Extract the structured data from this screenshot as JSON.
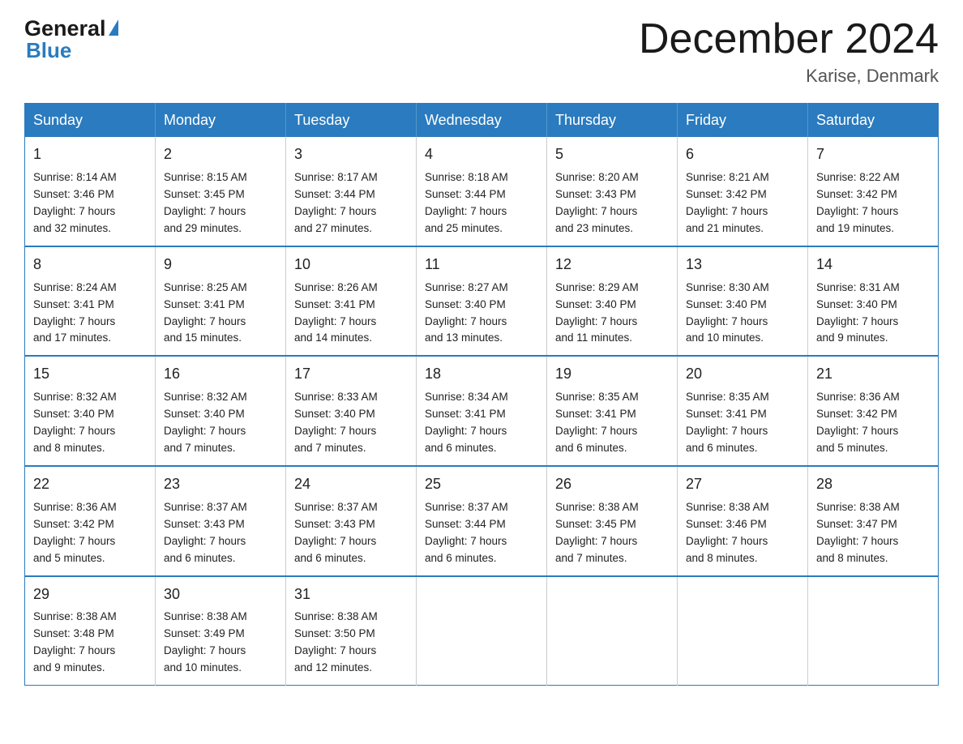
{
  "logo": {
    "general": "General",
    "blue": "Blue"
  },
  "title": "December 2024",
  "location": "Karise, Denmark",
  "weekdays": [
    "Sunday",
    "Monday",
    "Tuesday",
    "Wednesday",
    "Thursday",
    "Friday",
    "Saturday"
  ],
  "weeks": [
    [
      {
        "day": "1",
        "sunrise": "8:14 AM",
        "sunset": "3:46 PM",
        "daylight": "7 hours and 32 minutes."
      },
      {
        "day": "2",
        "sunrise": "8:15 AM",
        "sunset": "3:45 PM",
        "daylight": "7 hours and 29 minutes."
      },
      {
        "day": "3",
        "sunrise": "8:17 AM",
        "sunset": "3:44 PM",
        "daylight": "7 hours and 27 minutes."
      },
      {
        "day": "4",
        "sunrise": "8:18 AM",
        "sunset": "3:44 PM",
        "daylight": "7 hours and 25 minutes."
      },
      {
        "day": "5",
        "sunrise": "8:20 AM",
        "sunset": "3:43 PM",
        "daylight": "7 hours and 23 minutes."
      },
      {
        "day": "6",
        "sunrise": "8:21 AM",
        "sunset": "3:42 PM",
        "daylight": "7 hours and 21 minutes."
      },
      {
        "day": "7",
        "sunrise": "8:22 AM",
        "sunset": "3:42 PM",
        "daylight": "7 hours and 19 minutes."
      }
    ],
    [
      {
        "day": "8",
        "sunrise": "8:24 AM",
        "sunset": "3:41 PM",
        "daylight": "7 hours and 17 minutes."
      },
      {
        "day": "9",
        "sunrise": "8:25 AM",
        "sunset": "3:41 PM",
        "daylight": "7 hours and 15 minutes."
      },
      {
        "day": "10",
        "sunrise": "8:26 AM",
        "sunset": "3:41 PM",
        "daylight": "7 hours and 14 minutes."
      },
      {
        "day": "11",
        "sunrise": "8:27 AM",
        "sunset": "3:40 PM",
        "daylight": "7 hours and 13 minutes."
      },
      {
        "day": "12",
        "sunrise": "8:29 AM",
        "sunset": "3:40 PM",
        "daylight": "7 hours and 11 minutes."
      },
      {
        "day": "13",
        "sunrise": "8:30 AM",
        "sunset": "3:40 PM",
        "daylight": "7 hours and 10 minutes."
      },
      {
        "day": "14",
        "sunrise": "8:31 AM",
        "sunset": "3:40 PM",
        "daylight": "7 hours and 9 minutes."
      }
    ],
    [
      {
        "day": "15",
        "sunrise": "8:32 AM",
        "sunset": "3:40 PM",
        "daylight": "7 hours and 8 minutes."
      },
      {
        "day": "16",
        "sunrise": "8:32 AM",
        "sunset": "3:40 PM",
        "daylight": "7 hours and 7 minutes."
      },
      {
        "day": "17",
        "sunrise": "8:33 AM",
        "sunset": "3:40 PM",
        "daylight": "7 hours and 7 minutes."
      },
      {
        "day": "18",
        "sunrise": "8:34 AM",
        "sunset": "3:41 PM",
        "daylight": "7 hours and 6 minutes."
      },
      {
        "day": "19",
        "sunrise": "8:35 AM",
        "sunset": "3:41 PM",
        "daylight": "7 hours and 6 minutes."
      },
      {
        "day": "20",
        "sunrise": "8:35 AM",
        "sunset": "3:41 PM",
        "daylight": "7 hours and 6 minutes."
      },
      {
        "day": "21",
        "sunrise": "8:36 AM",
        "sunset": "3:42 PM",
        "daylight": "7 hours and 5 minutes."
      }
    ],
    [
      {
        "day": "22",
        "sunrise": "8:36 AM",
        "sunset": "3:42 PM",
        "daylight": "7 hours and 5 minutes."
      },
      {
        "day": "23",
        "sunrise": "8:37 AM",
        "sunset": "3:43 PM",
        "daylight": "7 hours and 6 minutes."
      },
      {
        "day": "24",
        "sunrise": "8:37 AM",
        "sunset": "3:43 PM",
        "daylight": "7 hours and 6 minutes."
      },
      {
        "day": "25",
        "sunrise": "8:37 AM",
        "sunset": "3:44 PM",
        "daylight": "7 hours and 6 minutes."
      },
      {
        "day": "26",
        "sunrise": "8:38 AM",
        "sunset": "3:45 PM",
        "daylight": "7 hours and 7 minutes."
      },
      {
        "day": "27",
        "sunrise": "8:38 AM",
        "sunset": "3:46 PM",
        "daylight": "7 hours and 8 minutes."
      },
      {
        "day": "28",
        "sunrise": "8:38 AM",
        "sunset": "3:47 PM",
        "daylight": "7 hours and 8 minutes."
      }
    ],
    [
      {
        "day": "29",
        "sunrise": "8:38 AM",
        "sunset": "3:48 PM",
        "daylight": "7 hours and 9 minutes."
      },
      {
        "day": "30",
        "sunrise": "8:38 AM",
        "sunset": "3:49 PM",
        "daylight": "7 hours and 10 minutes."
      },
      {
        "day": "31",
        "sunrise": "8:38 AM",
        "sunset": "3:50 PM",
        "daylight": "7 hours and 12 minutes."
      },
      null,
      null,
      null,
      null
    ]
  ],
  "labels": {
    "sunrise": "Sunrise:",
    "sunset": "Sunset:",
    "daylight": "Daylight:"
  }
}
